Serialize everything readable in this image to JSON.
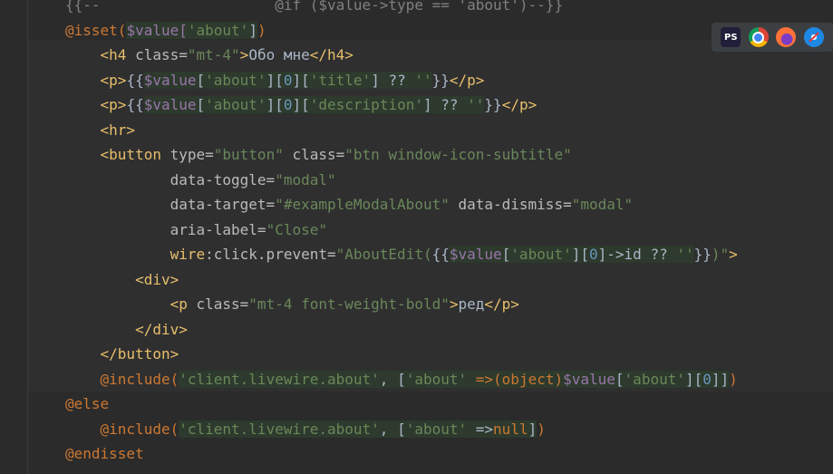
{
  "code_lines": [
    {
      "id": "l0",
      "tokens": [
        {
          "t": "{{--",
          "c": "t-com"
        },
        {
          "t": "                    ",
          "c": "t-text"
        },
        {
          "t": "@if ($value->type == 'about')--}}",
          "c": "t-com"
        }
      ]
    },
    {
      "id": "l1",
      "tokens": [
        {
          "t": "@isset(",
          "c": "t-dir"
        },
        {
          "t": "$value[",
          "c": "t-var php"
        },
        {
          "t": "'about'",
          "c": "t-str php"
        },
        {
          "t": "]",
          "c": "t-op php"
        },
        {
          "t": ")",
          "c": "t-dir"
        }
      ]
    },
    {
      "id": "l2",
      "tokens": [
        {
          "t": "    ",
          "c": "t-text"
        },
        {
          "t": "<h4",
          "c": "t-tag"
        },
        {
          "t": " class=",
          "c": "t-attr"
        },
        {
          "t": "\"mt-4\"",
          "c": "t-str"
        },
        {
          "t": ">",
          "c": "t-tag"
        },
        {
          "t": "Обо мне",
          "c": "t-text"
        },
        {
          "t": "</h4>",
          "c": "t-tag"
        }
      ]
    },
    {
      "id": "l3",
      "tokens": [
        {
          "t": "    ",
          "c": "t-text"
        },
        {
          "t": "<p>",
          "c": "t-tag"
        },
        {
          "t": "{{",
          "c": "t-text"
        },
        {
          "t": "$value",
          "c": "t-var php"
        },
        {
          "t": "[",
          "c": "t-op php"
        },
        {
          "t": "'about'",
          "c": "t-str php"
        },
        {
          "t": "][",
          "c": "t-op php"
        },
        {
          "t": "0",
          "c": "t-num php"
        },
        {
          "t": "][",
          "c": "t-op php"
        },
        {
          "t": "'title'",
          "c": "t-str php"
        },
        {
          "t": "] ?? ",
          "c": "t-op php"
        },
        {
          "t": "''",
          "c": "t-str php"
        },
        {
          "t": "}}",
          "c": "t-text"
        },
        {
          "t": "</p>",
          "c": "t-tag"
        }
      ]
    },
    {
      "id": "l4",
      "tokens": [
        {
          "t": "    ",
          "c": "t-text"
        },
        {
          "t": "<p>",
          "c": "t-tag"
        },
        {
          "t": "{{",
          "c": "t-text"
        },
        {
          "t": "$value",
          "c": "t-var php"
        },
        {
          "t": "[",
          "c": "t-op php"
        },
        {
          "t": "'about'",
          "c": "t-str php"
        },
        {
          "t": "][",
          "c": "t-op php"
        },
        {
          "t": "0",
          "c": "t-num php"
        },
        {
          "t": "][",
          "c": "t-op php"
        },
        {
          "t": "'description'",
          "c": "t-str php"
        },
        {
          "t": "] ?? ",
          "c": "t-op php"
        },
        {
          "t": "''",
          "c": "t-str php"
        },
        {
          "t": "}}",
          "c": "t-text"
        },
        {
          "t": "</p>",
          "c": "t-tag"
        }
      ]
    },
    {
      "id": "l5",
      "tokens": [
        {
          "t": "    ",
          "c": "t-text"
        },
        {
          "t": "<hr>",
          "c": "t-tag"
        }
      ]
    },
    {
      "id": "l6",
      "tokens": [
        {
          "t": "    ",
          "c": "t-text"
        },
        {
          "t": "<button",
          "c": "t-tag"
        },
        {
          "t": " type=",
          "c": "t-attr"
        },
        {
          "t": "\"button\"",
          "c": "t-str"
        },
        {
          "t": " class=",
          "c": "t-attr"
        },
        {
          "t": "\"btn window-icon-subtitle\"",
          "c": "t-str"
        }
      ]
    },
    {
      "id": "l7",
      "tokens": [
        {
          "t": "            ",
          "c": "t-text"
        },
        {
          "t": "data-toggle=",
          "c": "t-attr"
        },
        {
          "t": "\"modal\"",
          "c": "t-str"
        }
      ]
    },
    {
      "id": "l8",
      "tokens": [
        {
          "t": "            ",
          "c": "t-text"
        },
        {
          "t": "data-target=",
          "c": "t-attr"
        },
        {
          "t": "\"#exampleModalAbout\"",
          "c": "t-str"
        },
        {
          "t": " data-dismiss=",
          "c": "t-attr"
        },
        {
          "t": "\"modal\"",
          "c": "t-str"
        }
      ]
    },
    {
      "id": "l9",
      "tokens": [
        {
          "t": "            ",
          "c": "t-text"
        },
        {
          "t": "aria-label=",
          "c": "t-attr"
        },
        {
          "t": "\"Close\"",
          "c": "t-str"
        }
      ]
    },
    {
      "id": "l10",
      "tokens": [
        {
          "t": "            ",
          "c": "t-text"
        },
        {
          "t": "wire",
          "c": "t-tag"
        },
        {
          "t": ":click.prevent=",
          "c": "t-attr"
        },
        {
          "t": "\"AboutEdit(",
          "c": "t-str"
        },
        {
          "t": "{{",
          "c": "t-text"
        },
        {
          "t": "$value",
          "c": "t-var php"
        },
        {
          "t": "[",
          "c": "t-op php"
        },
        {
          "t": "'about'",
          "c": "t-str php"
        },
        {
          "t": "][",
          "c": "t-op php"
        },
        {
          "t": "0",
          "c": "t-num php"
        },
        {
          "t": "]->id ?? ",
          "c": "t-op php"
        },
        {
          "t": "''",
          "c": "t-str php"
        },
        {
          "t": "}}",
          "c": "t-text"
        },
        {
          "t": ")\"",
          "c": "t-str"
        },
        {
          "t": ">",
          "c": "t-tag"
        }
      ]
    },
    {
      "id": "l11",
      "tokens": [
        {
          "t": "        ",
          "c": "t-text"
        },
        {
          "t": "<div>",
          "c": "t-tag"
        }
      ]
    },
    {
      "id": "l12",
      "tokens": [
        {
          "t": "            ",
          "c": "t-text"
        },
        {
          "t": "<p",
          "c": "t-tag"
        },
        {
          "t": " class=",
          "c": "t-attr"
        },
        {
          "t": "\"mt-4 font-weight-bold\"",
          "c": "t-str"
        },
        {
          "t": ">",
          "c": "t-tag"
        },
        {
          "t": "ред",
          "c": "t-text"
        },
        {
          "t": "</p>",
          "c": "t-tag"
        }
      ]
    },
    {
      "id": "l13",
      "tokens": [
        {
          "t": "        ",
          "c": "t-text"
        },
        {
          "t": "</div>",
          "c": "t-tag"
        }
      ]
    },
    {
      "id": "l14",
      "tokens": [
        {
          "t": "    ",
          "c": "t-text"
        },
        {
          "t": "</button>",
          "c": "t-tag"
        }
      ]
    },
    {
      "id": "l15",
      "tokens": [
        {
          "t": "    ",
          "c": "t-text"
        },
        {
          "t": "@include(",
          "c": "t-dir"
        },
        {
          "t": "'client.livewire.about'",
          "c": "t-str php"
        },
        {
          "t": ", [",
          "c": "t-op php"
        },
        {
          "t": "'about'",
          "c": "t-str php"
        },
        {
          "t": " =>(object)",
          "c": "t-kw php"
        },
        {
          "t": "$value",
          "c": "t-var php"
        },
        {
          "t": "[",
          "c": "t-op php"
        },
        {
          "t": "'about'",
          "c": "t-str php"
        },
        {
          "t": "][",
          "c": "t-op php"
        },
        {
          "t": "0",
          "c": "t-num php"
        },
        {
          "t": "]]",
          "c": "t-op php"
        },
        {
          "t": ")",
          "c": "t-dir"
        }
      ]
    },
    {
      "id": "l16",
      "tokens": [
        {
          "t": "@else",
          "c": "t-dir"
        }
      ]
    },
    {
      "id": "l17",
      "tokens": [
        {
          "t": "    ",
          "c": "t-text"
        },
        {
          "t": "@include(",
          "c": "t-dir"
        },
        {
          "t": "'client.livewire.about'",
          "c": "t-str php"
        },
        {
          "t": ", [",
          "c": "t-op php"
        },
        {
          "t": "'about'",
          "c": "t-str php"
        },
        {
          "t": " =>",
          "c": "t-op php"
        },
        {
          "t": "null",
          "c": "t-kw php"
        },
        {
          "t": "]",
          "c": "t-op php"
        },
        {
          "t": ")",
          "c": "t-dir"
        }
      ]
    },
    {
      "id": "l18",
      "tokens": [
        {
          "t": "@endisset",
          "c": "t-dir"
        }
      ]
    }
  ],
  "tray_icons": [
    {
      "name": "phpstorm-icon",
      "label": "PS",
      "bg": "#1f1f3a",
      "fg": "#ffffff"
    },
    {
      "name": "chrome-icon",
      "label": "",
      "bg": "#db4437",
      "fg": "#ffffff"
    },
    {
      "name": "firefox-icon",
      "label": "",
      "bg": "#ff7139",
      "fg": "#ffffff"
    },
    {
      "name": "safari-icon",
      "label": "",
      "bg": "#1e88e5",
      "fg": "#ffffff"
    }
  ]
}
